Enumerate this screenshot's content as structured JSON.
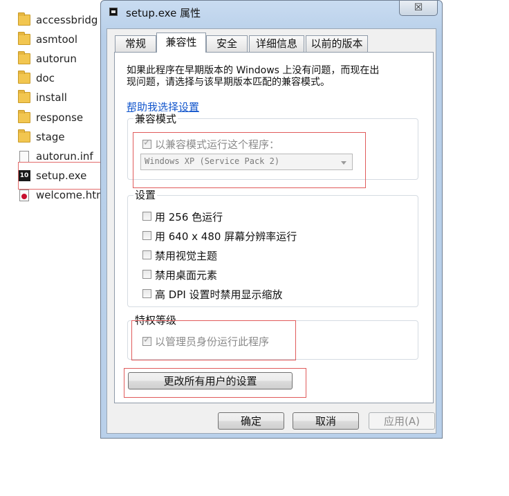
{
  "explorer": {
    "files": [
      {
        "name": "accessbridg",
        "type": "folder"
      },
      {
        "name": "asmtool",
        "type": "folder"
      },
      {
        "name": "autorun",
        "type": "folder"
      },
      {
        "name": "doc",
        "type": "folder"
      },
      {
        "name": "install",
        "type": "folder"
      },
      {
        "name": "response",
        "type": "folder"
      },
      {
        "name": "stage",
        "type": "folder"
      },
      {
        "name": "autorun.inf",
        "type": "file"
      },
      {
        "name": "setup.exe",
        "type": "exe",
        "icon_text": "10"
      },
      {
        "name": "welcome.htm",
        "type": "html"
      }
    ]
  },
  "dialog": {
    "title": "setup.exe 属性",
    "close_label": "☒",
    "tabs": [
      {
        "label": "常规",
        "active": false
      },
      {
        "label": "兼容性",
        "active": true
      },
      {
        "label": "安全",
        "active": false
      },
      {
        "label": "详细信息",
        "active": false
      },
      {
        "label": "以前的版本",
        "active": false
      }
    ],
    "intro_line1": "如果此程序在早期版本的 Windows 上没有问题，而现在出",
    "intro_line2": "现问题，请选择与该早期版本匹配的兼容模式。",
    "help_link": "帮助我选择设置",
    "compat_group": {
      "label": "兼容模式",
      "checkbox_label": "以兼容模式运行这个程序：",
      "checked": true,
      "os_selected": "Windows XP (Service Pack 2)"
    },
    "settings_group": {
      "label": "设置",
      "options": [
        "用 256 色运行",
        "用 640 x 480 屏幕分辨率运行",
        "禁用视觉主题",
        "禁用桌面元素",
        "高 DPI 设置时禁用显示缩放"
      ]
    },
    "privilege_group": {
      "label": "特权等级",
      "checkbox_label": "以管理员身份运行此程序",
      "checked": true
    },
    "change_all_users_button": "更改所有用户的设置",
    "buttons": {
      "ok": "确定",
      "cancel": "取消",
      "apply": "应用(A)"
    },
    "colors": {
      "highlight_box": "#e05a5a",
      "link": "#1155cc",
      "frame": "#b9d0ea"
    }
  }
}
